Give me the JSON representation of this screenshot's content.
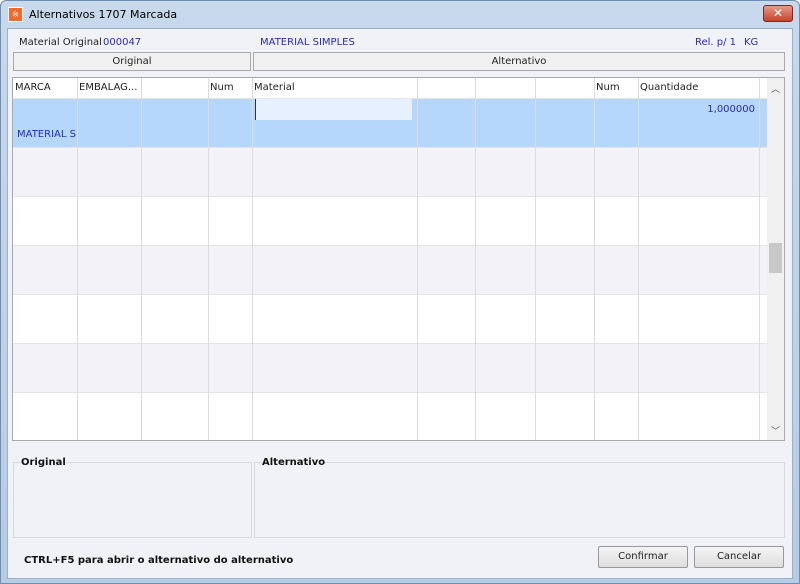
{
  "window": {
    "title": "Alternativos 1707 Marcada",
    "close_label": "✕",
    "icon": "app-logo-icon"
  },
  "info": {
    "material_label": "Material Original",
    "material_code": "000047",
    "material_name": "MATERIAL SIMPLES",
    "relation": "Rel. p/ 1",
    "unit": "KG"
  },
  "sections": {
    "original": "Original",
    "alternativo": "Alternativo"
  },
  "grid": {
    "columns": [
      "MARCA",
      "EMBALAG...",
      "",
      "Num",
      "Material",
      "",
      "",
      "",
      "Num",
      "Quantidade"
    ],
    "rows": [
      {
        "marca": "MATERIAL SI",
        "quantidade": "1,000000",
        "selected": true
      },
      {},
      {},
      {},
      {},
      {},
      {}
    ],
    "selection_color": "#b4d7fb"
  },
  "groups": {
    "original": "Original",
    "alternativo": "Alternativo"
  },
  "footer": {
    "hint": "CTRL+F5 para abrir o alternativo do alternativo",
    "confirm": "Confirmar",
    "cancel": "Cancelar"
  }
}
